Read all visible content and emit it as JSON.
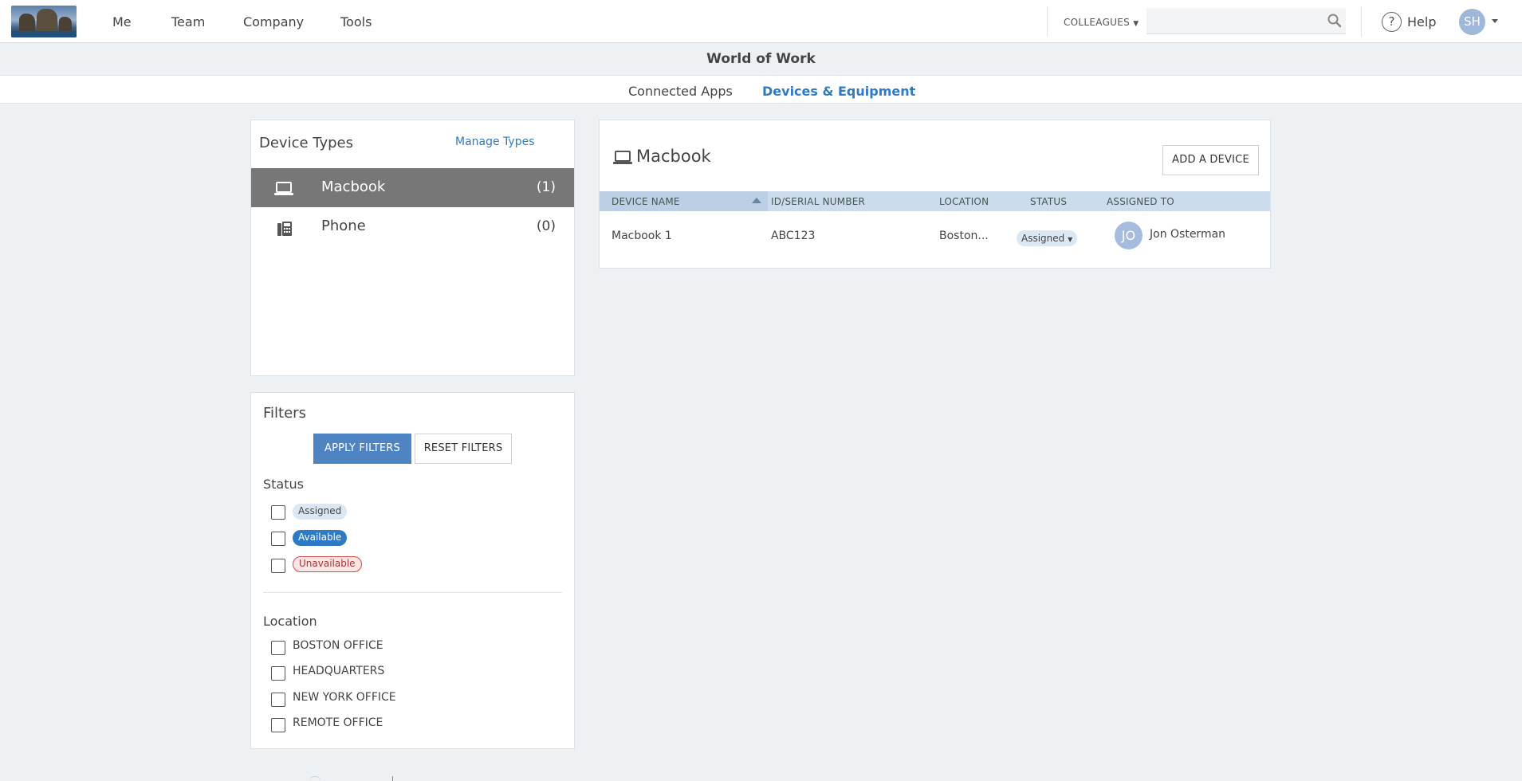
{
  "topnav": {
    "menu": [
      "Me",
      "Team",
      "Company",
      "Tools"
    ],
    "colleagues_label": "COLLEAGUES",
    "search": {
      "value": "",
      "placeholder": ""
    },
    "help_label": "Help",
    "user_initials": "SH"
  },
  "page": {
    "title": "World of Work",
    "tabs": [
      {
        "label": "Connected Apps",
        "active": false
      },
      {
        "label": "Devices & Equipment",
        "active": true
      }
    ]
  },
  "device_types": {
    "title": "Device Types",
    "manage_link": "Manage Types",
    "items": [
      {
        "name": "Macbook",
        "count": "(1)",
        "icon": "laptop-icon",
        "selected": true
      },
      {
        "name": "Phone",
        "count": "(0)",
        "icon": "phone-icon",
        "selected": false
      }
    ]
  },
  "filters": {
    "title": "Filters",
    "apply_label": "APPLY FILTERS",
    "reset_label": "RESET FILTERS",
    "status_label": "Status",
    "statuses": [
      "Assigned",
      "Available",
      "Unavailable"
    ],
    "location_label": "Location",
    "locations": [
      "BOSTON OFFICE",
      "HEADQUARTERS",
      "NEW YORK OFFICE",
      "REMOTE OFFICE"
    ]
  },
  "devices": {
    "title": "Macbook",
    "add_button": "ADD A DEVICE",
    "columns": [
      "DEVICE NAME",
      "ID/SERIAL NUMBER",
      "LOCATION",
      "STATUS",
      "ASSIGNED TO"
    ],
    "rows": [
      {
        "name": "Macbook 1",
        "serial": "ABC123",
        "location": "Boston...",
        "status": "Assigned",
        "assignee_initials": "JO",
        "assignee": "Jon Osterman"
      }
    ]
  },
  "colors": {
    "accent": "#2f7ac4",
    "apply_button": "#4f84c4",
    "selected_row": "#777777",
    "table_header": "#cddcec"
  }
}
